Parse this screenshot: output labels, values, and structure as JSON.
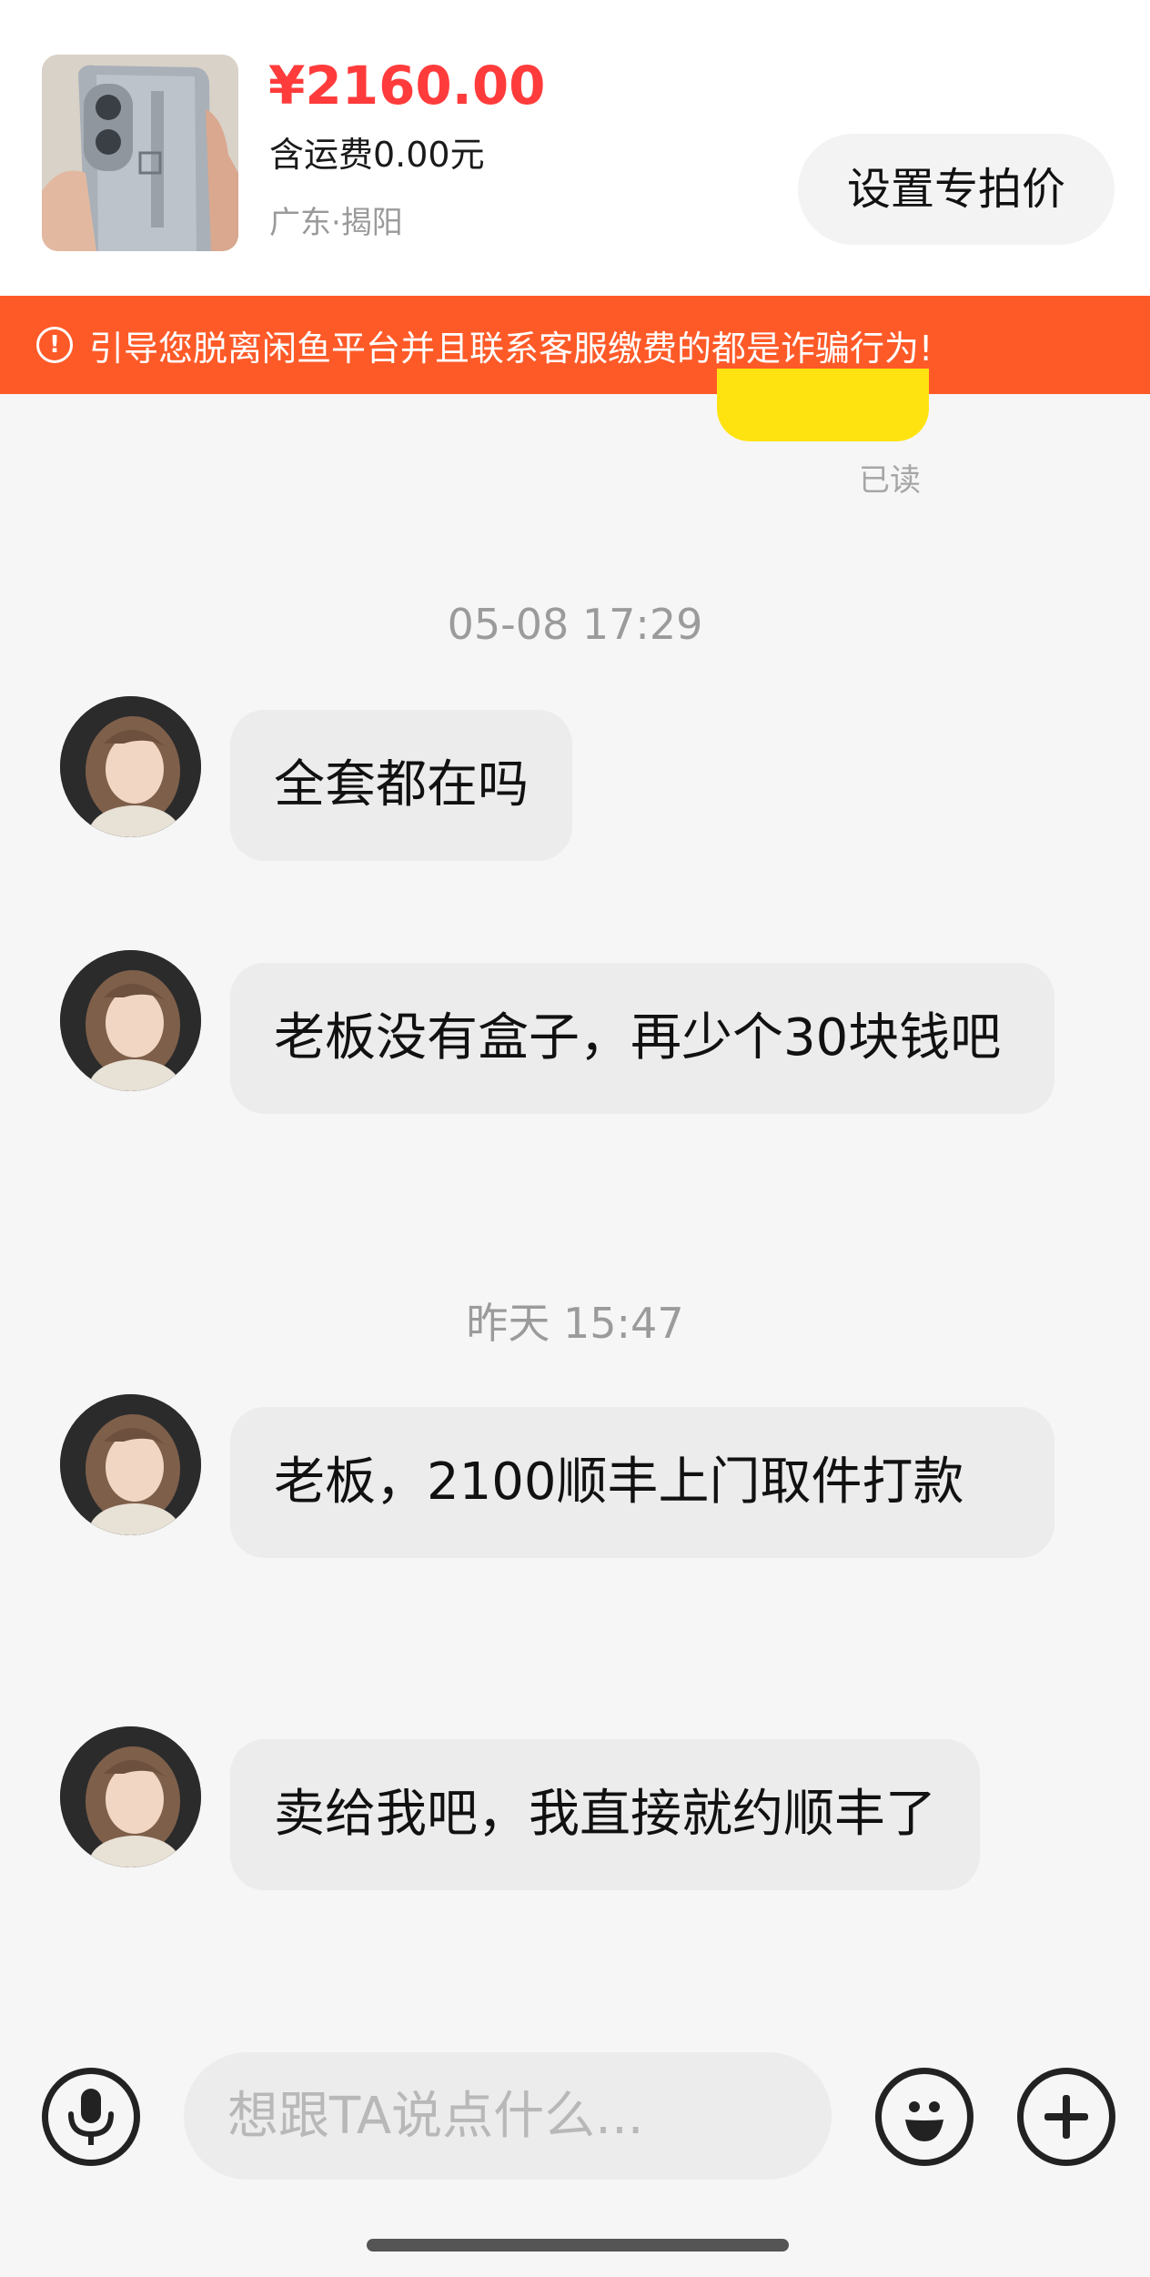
{
  "product": {
    "price": "¥2160.00",
    "shipping": "含运费0.00元",
    "location": "广东·揭阳",
    "set_price_button": "设置专拍价"
  },
  "warning": {
    "icon_glyph": "!",
    "text": "引导您脱离闲鱼平台并且联系客服缴费的都是诈骗行为!"
  },
  "chat": {
    "read_status": "已读",
    "timestamps": [
      "05-08 17:29",
      "昨天 15:47"
    ],
    "messages": [
      {
        "text": "全套都在吗"
      },
      {
        "text": "老板没有盒子，再少个30块钱吧"
      },
      {
        "text": "老板，2100顺丰上门取件打款"
      },
      {
        "text": "卖给我吧，我直接就约顺丰了"
      }
    ]
  },
  "input_bar": {
    "placeholder": "想跟TA说点什么...",
    "icons": [
      "microphone-icon",
      "emoji-icon",
      "plus-icon"
    ]
  },
  "colors": {
    "price": "#ff3b3b",
    "warning_banner": "#fe5a28",
    "sent_bubble": "#ffe311",
    "received_bubble": "#ececec"
  }
}
